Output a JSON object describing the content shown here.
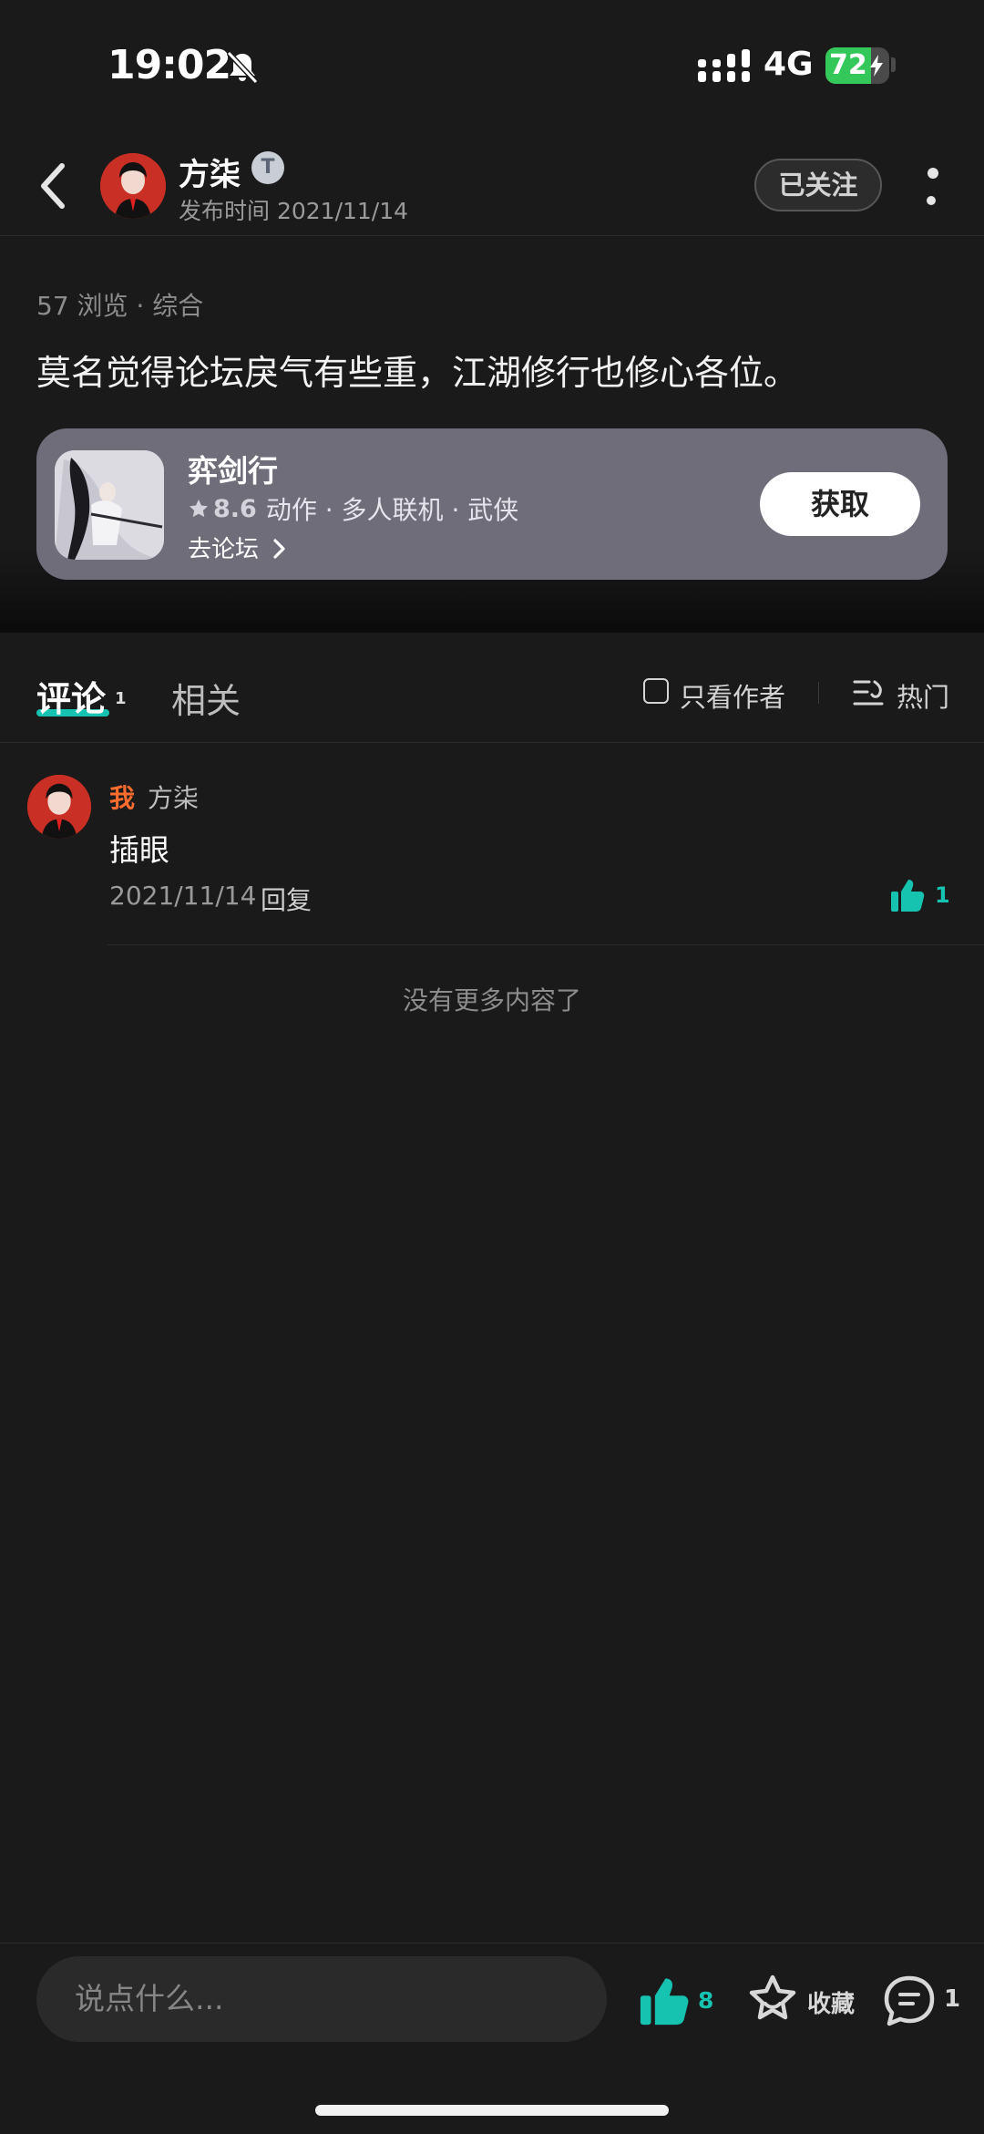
{
  "status_bar": {
    "time": "19:02",
    "network": "4G",
    "battery": "72",
    "battery_level": 0.72,
    "icons": [
      "bell-slash-icon",
      "signal-icon",
      "charging-icon"
    ]
  },
  "header": {
    "author_name": "方柒",
    "badge": "T",
    "publish_time": "发布时间 2021/11/14",
    "follow_label": "已关注"
  },
  "post": {
    "meta": "57 浏览 · 综合",
    "text": "莫名觉得论坛戾气有些重，江湖修行也修心各位。"
  },
  "game_card": {
    "title": "弈剑行",
    "rating": "8.6",
    "tags": "动作 · 多人联机 · 武侠",
    "forum_link": "去论坛",
    "get_label": "获取",
    "bg_color": "#6f6d7a"
  },
  "tabs": {
    "comments_label": "评论",
    "comments_count": "1",
    "related_label": "相关",
    "author_only_label": "只看作者",
    "sort_label": "热门"
  },
  "comments": [
    {
      "me_tag": "我",
      "name": "方柒",
      "text": "插眼",
      "date": "2021/11/14",
      "reply_label": "回复",
      "likes": "1"
    }
  ],
  "no_more": "没有更多内容了",
  "bottom_bar": {
    "input_placeholder": "说点什么...",
    "likes": "8",
    "fav_label": "收藏",
    "comments": "1"
  },
  "colors": {
    "accent": "#16c2b0",
    "me_tag": "#ff6c2e",
    "background": "#1a1a1a"
  }
}
